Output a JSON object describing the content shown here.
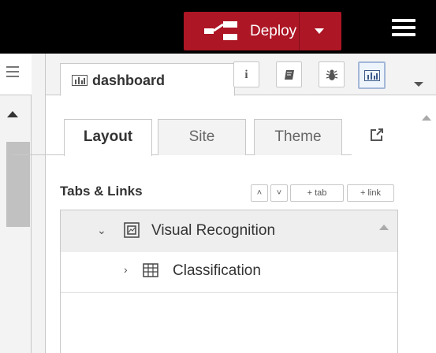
{
  "header": {
    "deploy_label": "Deploy",
    "deploy_color": "#ad1625",
    "deploy_icon": "deploy-icon",
    "menu_icon": "hamburger-menu-icon"
  },
  "sidebar": {
    "tab_label": "dashboard",
    "tab_icon": "bar-chart-icon",
    "toolbar": [
      {
        "icon": "info-icon",
        "glyph": "i"
      },
      {
        "icon": "book-icon",
        "glyph": ""
      },
      {
        "icon": "bug-icon",
        "glyph": ""
      },
      {
        "icon": "dashboard-icon",
        "glyph": "",
        "active": true
      }
    ]
  },
  "dashboard": {
    "tabs": [
      "Layout",
      "Site",
      "Theme"
    ],
    "active_tab": "Layout",
    "section_title": "Tabs & Links",
    "buttons": {
      "collapse": "˄",
      "expand": "˅",
      "add_tab": "+ tab",
      "add_link": "+ link"
    },
    "tree": [
      {
        "label": "Visual Recognition",
        "expanded": true,
        "level": 0
      },
      {
        "label": "Classification",
        "expanded": false,
        "level": 1
      }
    ]
  }
}
